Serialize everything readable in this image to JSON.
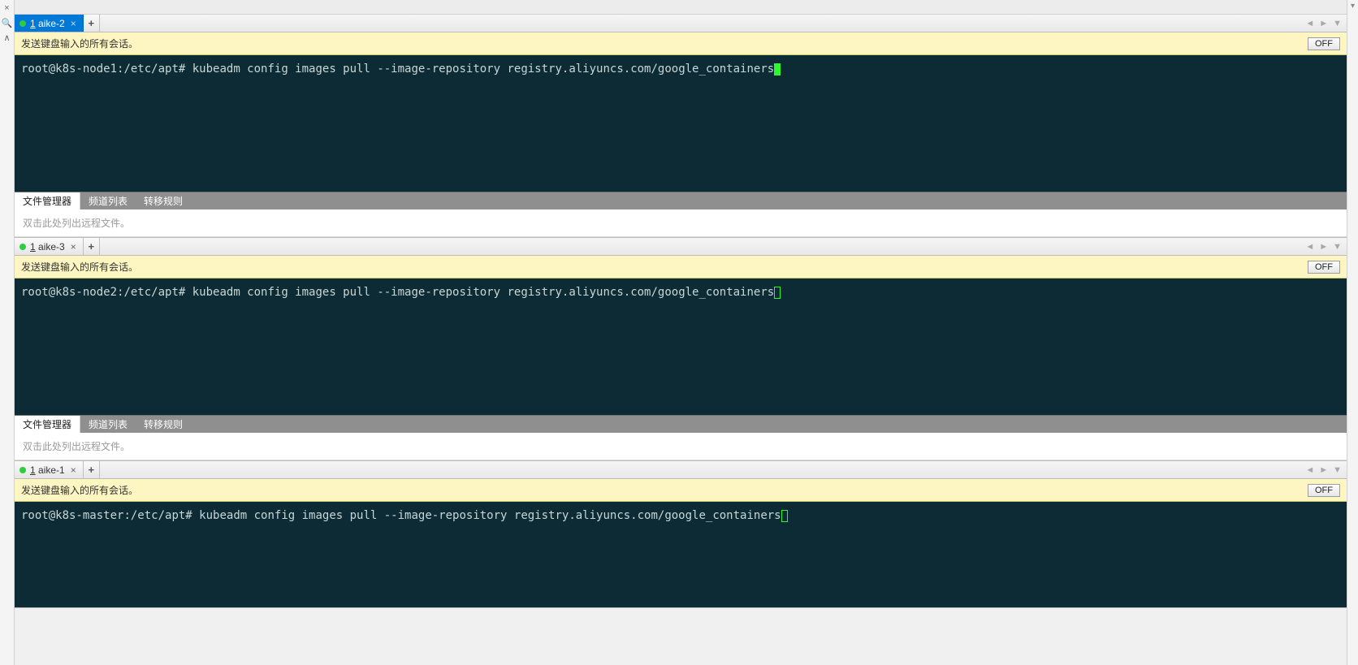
{
  "left_gutter": {
    "close": "×",
    "search": "🔍",
    "jump": "∧"
  },
  "right_gutter": {
    "dropdown": "▾"
  },
  "tab_nav": {
    "left": "◄",
    "right": "►",
    "down": "▼"
  },
  "off_label": "OFF",
  "broadcast_msg": "发送键盘输入的所有会话。",
  "sub_tabs": {
    "file_mgr": "文件管理器",
    "channel_list": "频道列表",
    "transfer_rules": "转移规则"
  },
  "file_hint": "双击此处列出远程文件。",
  "panes": [
    {
      "tab_num": "1",
      "tab_label": "aike-2",
      "tab_active": true,
      "prompt_user": "root@k8s-node1",
      "prompt_path": ":/etc/apt#",
      "command": "kubeadm config images pull --image-repository registry.aliyuncs.com/google_containers",
      "cursor": "fill"
    },
    {
      "tab_num": "1",
      "tab_label": "aike-3",
      "tab_active": false,
      "prompt_user": "root@k8s-node2",
      "prompt_path": ":/etc/apt#",
      "command": "kubeadm config images pull --image-repository registry.aliyuncs.com/google_containers",
      "cursor": "box"
    },
    {
      "tab_num": "1",
      "tab_label": "aike-1",
      "tab_active": false,
      "prompt_user": "root@k8s-master",
      "prompt_path": ":/etc/apt#",
      "command": "kubeadm config images pull --image-repository registry.aliyuncs.com/google_containers",
      "cursor": "box"
    }
  ]
}
